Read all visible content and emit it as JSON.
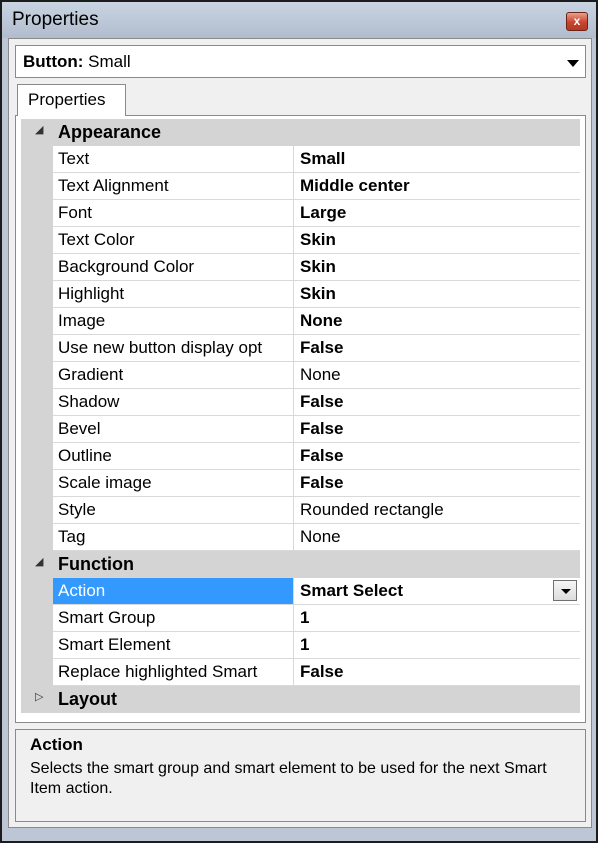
{
  "window": {
    "title": "Properties",
    "close_glyph": "x"
  },
  "selector": {
    "object_type": "Button:",
    "object_name": "Small"
  },
  "tabs": [
    {
      "label": "Properties"
    }
  ],
  "categories": [
    {
      "label": "Appearance",
      "expanded": true,
      "rows": [
        {
          "name": "Text",
          "value": "Small",
          "bold": true
        },
        {
          "name": "Text Alignment",
          "value": "Middle center",
          "bold": true
        },
        {
          "name": "Font",
          "value": "Large",
          "bold": true
        },
        {
          "name": "Text Color",
          "value": "Skin",
          "bold": true
        },
        {
          "name": "Background Color",
          "value": "Skin",
          "bold": true
        },
        {
          "name": "Highlight",
          "value": "Skin",
          "bold": true
        },
        {
          "name": "Image",
          "value": "None",
          "bold": true
        },
        {
          "name": "Use new button display opt",
          "value": "False",
          "bold": true
        },
        {
          "name": "Gradient",
          "value": "None",
          "bold": false
        },
        {
          "name": "Shadow",
          "value": "False",
          "bold": true
        },
        {
          "name": "Bevel",
          "value": "False",
          "bold": true
        },
        {
          "name": "Outline",
          "value": "False",
          "bold": true
        },
        {
          "name": "Scale image",
          "value": "False",
          "bold": true
        },
        {
          "name": "Style",
          "value": "Rounded rectangle",
          "bold": false
        },
        {
          "name": "Tag",
          "value": "None",
          "bold": false
        }
      ]
    },
    {
      "label": "Function",
      "expanded": true,
      "rows": [
        {
          "name": "Action",
          "value": "Smart Select",
          "bold": true,
          "selected": true,
          "dropdown": true
        },
        {
          "name": "Smart Group",
          "value": "1",
          "bold": true
        },
        {
          "name": "Smart Element",
          "value": "1",
          "bold": true
        },
        {
          "name": "Replace highlighted Smart",
          "value": "False",
          "bold": true
        }
      ]
    },
    {
      "label": "Layout",
      "expanded": false,
      "rows": []
    }
  ],
  "help": {
    "title": "Action",
    "description": "Selects the smart group and smart element to be used for the next Smart Item action."
  },
  "icons": {
    "expanded": "collapse-triangle-icon",
    "collapsed": "expand-triangle-icon",
    "close": "close-icon",
    "dropdown": "chevron-down-icon"
  },
  "colors": {
    "selection": "#3399ff",
    "category_band": "#d4d4d4",
    "close_button": "#c9432c"
  }
}
